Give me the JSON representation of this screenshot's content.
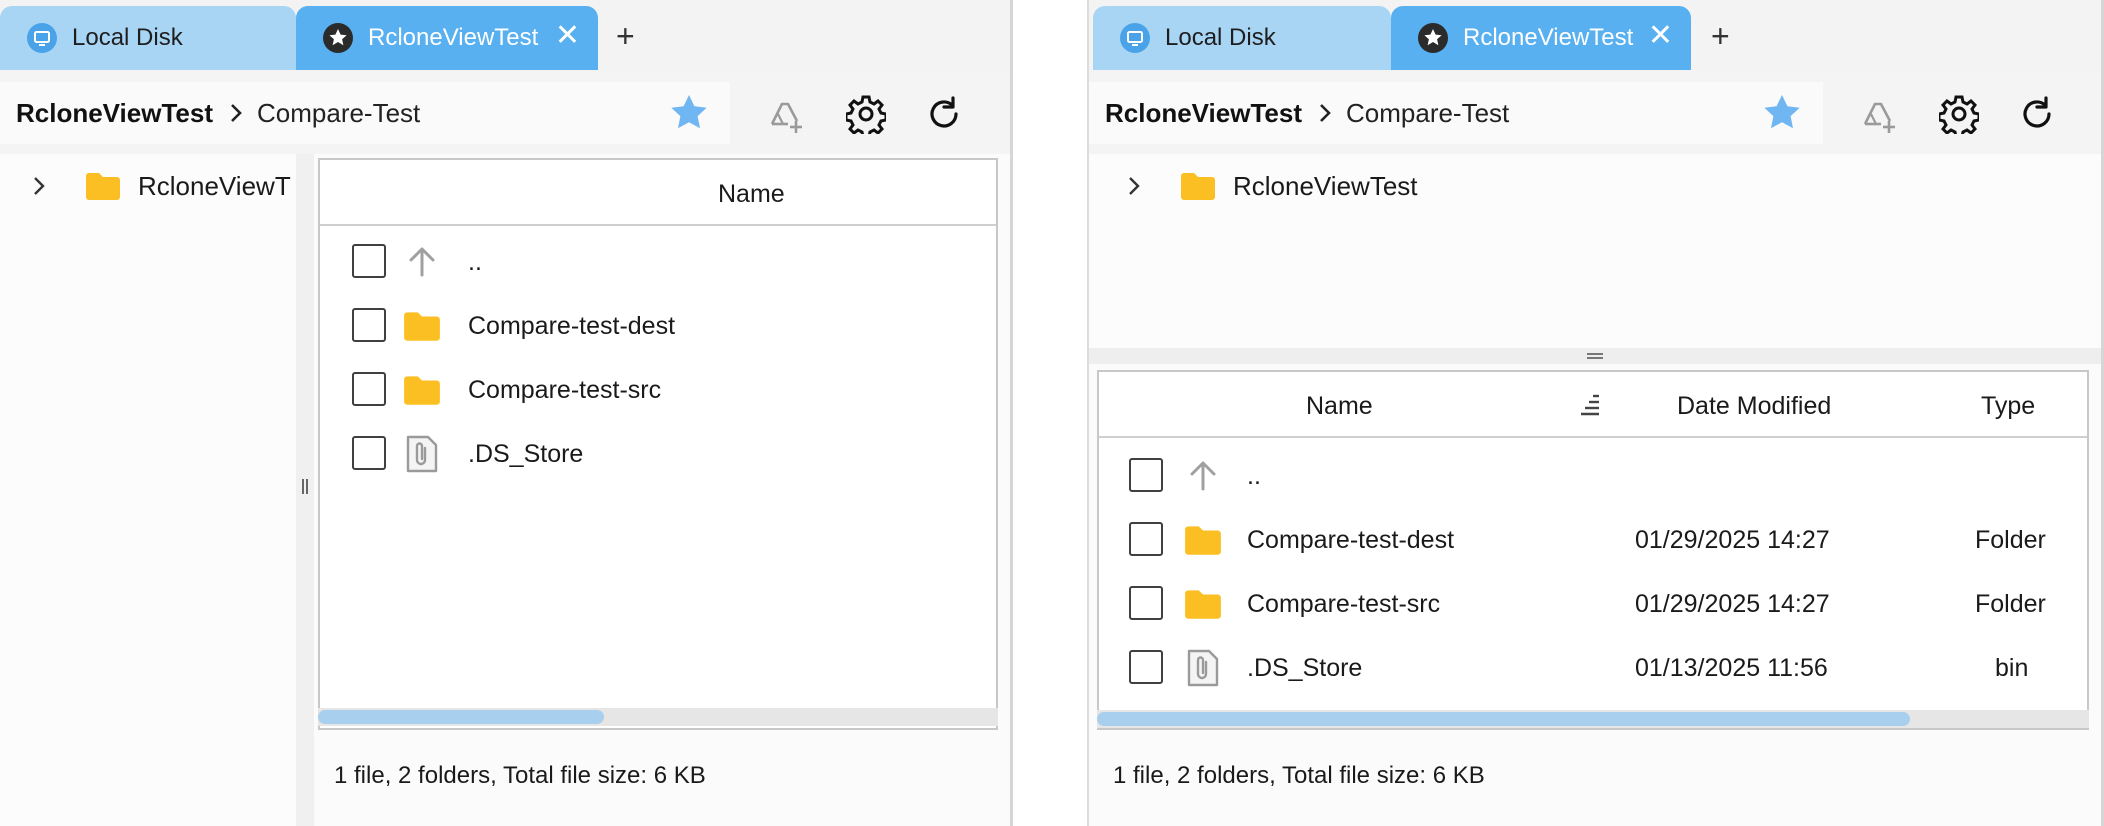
{
  "colors": {
    "tab_active": "#58b0f0",
    "tab_inactive": "#a9d5f5",
    "folder": "#fbbf24",
    "star": "#6fb6f2",
    "scroll_thumb": "#a9cfee"
  },
  "left": {
    "tabs": [
      {
        "label": "Local Disk",
        "icon": "monitor-icon"
      },
      {
        "label": "RcloneViewTest",
        "icon": "star-badge-icon",
        "close": "✕"
      }
    ],
    "add_tab": "+",
    "breadcrumb": {
      "root": "RcloneViewTest",
      "current": "Compare-Test"
    },
    "tree": {
      "item": "RcloneViewT"
    },
    "columns": {
      "name": "Name"
    },
    "rows": [
      {
        "name": "..",
        "icon": "arrow-up-icon"
      },
      {
        "name": "Compare-test-dest",
        "icon": "folder-icon"
      },
      {
        "name": "Compare-test-src",
        "icon": "folder-icon"
      },
      {
        "name": ".DS_Store",
        "icon": "file-attachment-icon"
      }
    ],
    "scroll_fraction": 0.42,
    "status": "1 file, 2 folders, Total file size: 6 KB"
  },
  "right": {
    "tabs": [
      {
        "label": "Local Disk",
        "icon": "monitor-icon"
      },
      {
        "label": "RcloneViewTest",
        "icon": "star-badge-icon",
        "close": "✕"
      }
    ],
    "add_tab": "+",
    "breadcrumb": {
      "root": "RcloneViewTest",
      "current": "Compare-Test"
    },
    "tree": {
      "item": "RcloneViewTest"
    },
    "columns": {
      "name": "Name",
      "date": "Date Modified",
      "type": "Type"
    },
    "rows": [
      {
        "name": "..",
        "date": "",
        "type": "",
        "icon": "arrow-up-icon"
      },
      {
        "name": "Compare-test-dest",
        "date": "01/29/2025 14:27",
        "type": "Folder",
        "icon": "folder-icon"
      },
      {
        "name": "Compare-test-src",
        "date": "01/29/2025 14:27",
        "type": "Folder",
        "icon": "folder-icon"
      },
      {
        "name": ".DS_Store",
        "date": "01/13/2025 11:56",
        "type": "bin",
        "icon": "file-attachment-icon"
      }
    ],
    "scroll_fraction": 0.82,
    "status": "1 file, 2 folders, Total file size: 6 KB"
  }
}
